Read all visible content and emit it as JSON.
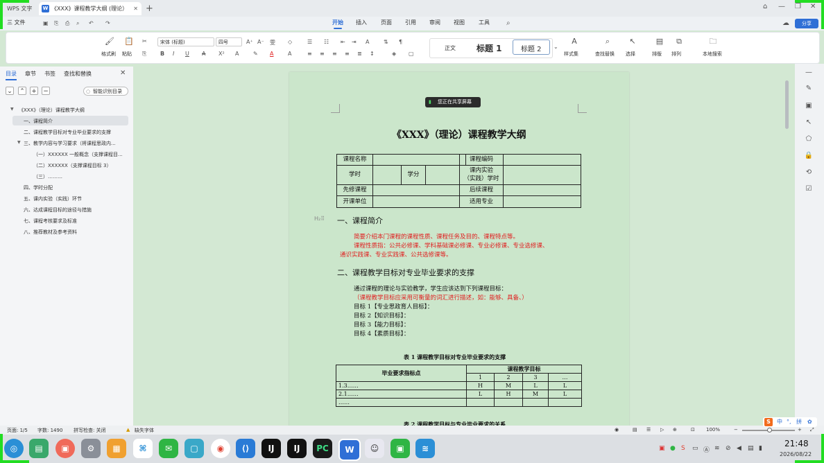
{
  "titlebar": {
    "app_tab": "WPS 文字",
    "doc_tab": "《XXX》课程教学大纲 (理论）",
    "new_tab": "+"
  },
  "menu": {
    "file": "三 文件",
    "tabs": [
      "开始",
      "插入",
      "页面",
      "引用",
      "审阅",
      "视图",
      "工具"
    ],
    "active_tab": "开始",
    "share": "分享"
  },
  "ribbon": {
    "format_painter": "格式刷",
    "paste": "粘贴",
    "font_name": "宋体 (标题)",
    "font_size": "四号",
    "style_normal": "正文",
    "style_h1": "标题 1",
    "style_h2": "标题 2",
    "style_set": "样式集",
    "find_replace": "查找替换",
    "select": "选择",
    "layout": "排版",
    "arrange": "排列",
    "local_search": "本地搜索"
  },
  "nav": {
    "tabs": [
      "目录",
      "章节",
      "书签",
      "查找和替换"
    ],
    "smart_toc": "智能识别目录",
    "items": [
      "《XXX》（理论）课程教学大纲",
      "一、课程简介",
      "二、课程教学目标对专业毕业要求的支撑",
      "三、教学内容与学习要求（将课程思政内...",
      "（一）XXXXXX 一般概念（支撑课程目...",
      "（二）XXXXXX（支撑课程目标 3）",
      "（三）………",
      "四、学时分配",
      "五、课内实验（实践）环节",
      "六、达成课程目标的途径与措施",
      "七、课程考核要求及标准",
      "八、推荐教材及参考资料"
    ]
  },
  "doc": {
    "sharing": "您正在共享屏幕",
    "title": "《XXX》（理论）课程教学大纲",
    "info_table": {
      "course_name": "课程名称",
      "course_code": "课程编码",
      "hours": "学时",
      "credits": "学分",
      "lab_hours_1": "课内实验",
      "lab_hours_2": "（实践）学时",
      "prereq": "先修课程",
      "followup": "后续课程",
      "unit": "开课单位",
      "major": "适用专业"
    },
    "section1": "一、课程简介",
    "s1_p1": "简要介绍本门课程的课程性质、课程任务及目的、课程特点等。",
    "s1_p2": "课程性质指：公共必修课、学科基础课必修课、专业必修课、专业选修课、",
    "s1_p3": "通识实践课、专业实践课、公共选修课等。",
    "section2": "二、课程教学目标对专业毕业要求的支撑",
    "s2_p1": "通过课程的理论与实验教学，学生应该达到下列课程目标：",
    "s2_p2": "（课程教学目标应采用可衡量的词汇进行描述，如：能够、具备、）",
    "goals": [
      "目标 1【专业思政育人目标】：",
      "目标 2【知识目标】：",
      "目标 3【能力目标】：",
      "目标 4【素质目标】："
    ],
    "table1_caption": "表 1 课程教学目标对专业毕业要求的支撑",
    "table1": {
      "col_head": "毕业要求指标点",
      "group_head": "课程教学目标",
      "targets": [
        "1",
        "2",
        "3",
        "…"
      ],
      "rows": [
        {
          "label": "1.3……",
          "vals": [
            "H",
            "M",
            "L",
            "L"
          ]
        },
        {
          "label": "2.1……",
          "vals": [
            "L",
            "H",
            "M",
            "L"
          ]
        },
        {
          "label": "……",
          "vals": [
            "",
            "",
            "",
            ""
          ]
        }
      ]
    },
    "table2_caption": "表 2 课程教学目标与专业毕业要求的关系"
  },
  "status": {
    "page": "页面: 1/5",
    "words": "字数: 1490",
    "spell": "拼写检查: 关闭",
    "missing_font": "缺失字体",
    "zoom": "100%"
  },
  "taskbar": {
    "time": "21:48",
    "date": "2026/08/22",
    "ime": "中"
  }
}
